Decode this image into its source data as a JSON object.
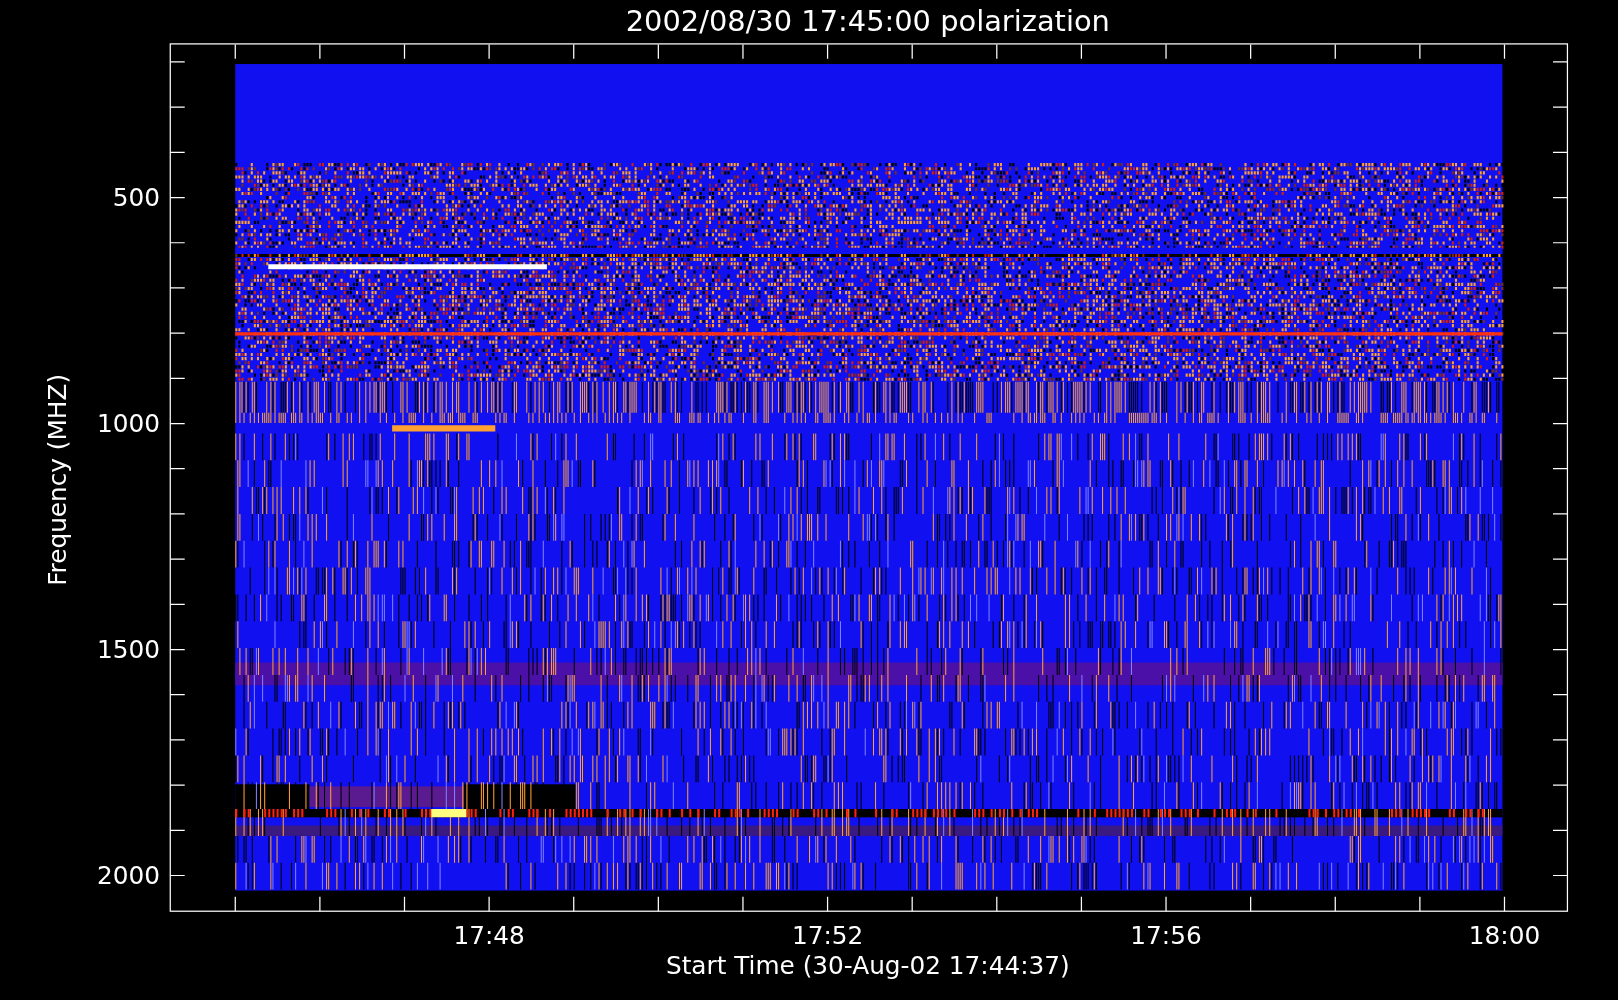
{
  "plot": {
    "title": "2002/08/30 17:45:00 polarization",
    "ylabel": "Frequency (MHZ)",
    "xlabel": "Start Time (30-Aug-02 17:44:37)",
    "yticks": [
      "500",
      "1000",
      "1500",
      "2000"
    ],
    "xticks": [
      "17:48",
      "17:52",
      "17:56",
      "18:00"
    ]
  }
}
